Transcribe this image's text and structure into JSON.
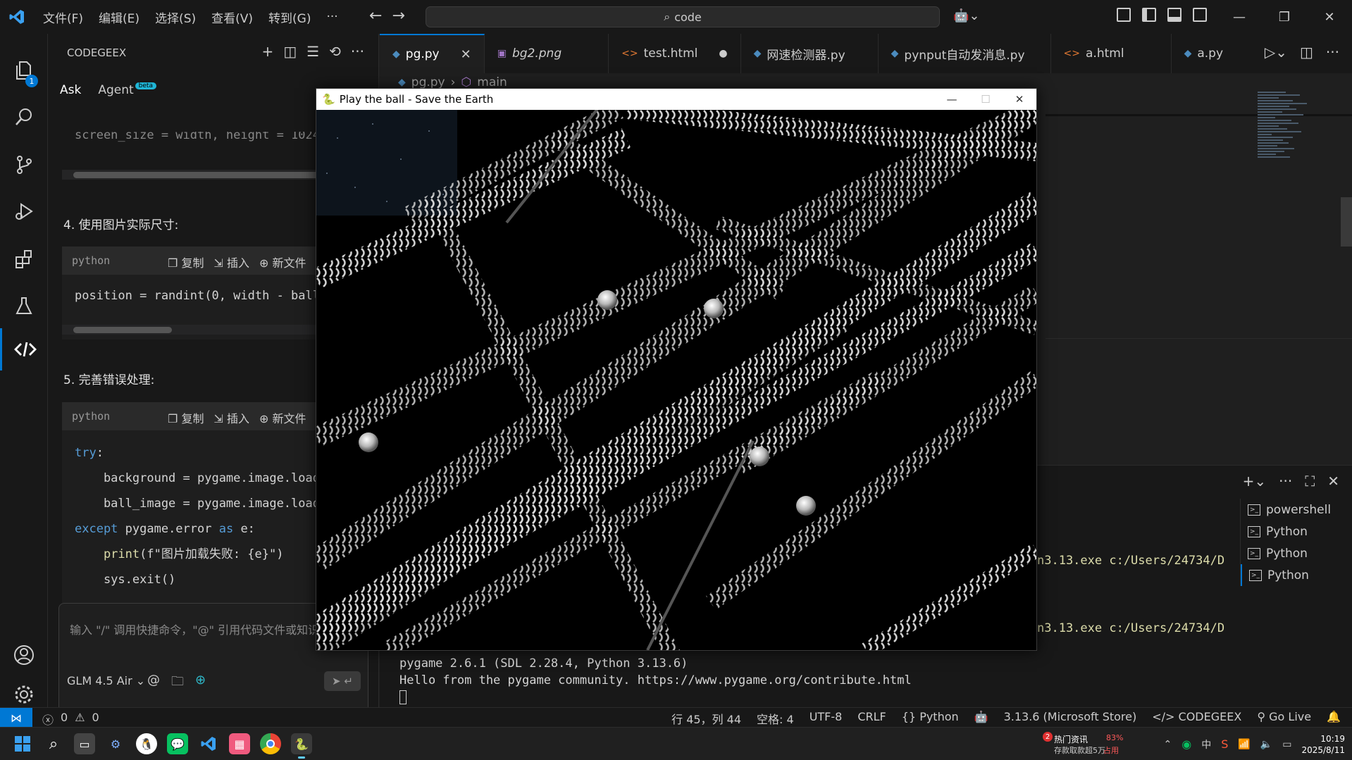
{
  "titlebar": {
    "menu": [
      "文件(F)",
      "编辑(E)",
      "选择(S)",
      "查看(V)",
      "转到(G)",
      "···"
    ],
    "search": "code"
  },
  "activity": {
    "explorer_badge": "1"
  },
  "sidepanel": {
    "title": "CODEGEEX",
    "tabs": {
      "ask": "Ask",
      "agent": "Agent",
      "beta": "beta"
    },
    "partial_line": "screen_size = width, height = 1024",
    "step4": "4. 使用图片实际尺寸:",
    "step5": "5. 完善错误处理:",
    "code_lang": "python",
    "code_actions": {
      "copy": "复制",
      "insert": "插入",
      "newfile": "新文件"
    },
    "code4": "position = randint(0, width - ball",
    "code5": {
      "l1_kw": "try",
      "l1_rest": ":",
      "l2": "    background = pygame.image.load",
      "l3": "    ball_image = pygame.image.load",
      "l4_kw": "except",
      "l4_mid": " pygame.error ",
      "l4_as": "as",
      "l4_rest": " e:",
      "l5_fn": "    print",
      "l5_rest": "(f\"图片加载失败: {e}\")",
      "l6": "    sys.exit()"
    },
    "input_placeholder": "输入 \"/\" 调用快捷命令，\"@\" 引用代码文件或知识",
    "model": "GLM 4.5 Air"
  },
  "tabs": [
    {
      "name": "pg.py",
      "kind": "py",
      "active": true,
      "suffix": "close"
    },
    {
      "name": "bg2.png",
      "kind": "img",
      "italic": true
    },
    {
      "name": "test.html",
      "kind": "html",
      "suffix": "dot"
    },
    {
      "name": "网速检测器.py",
      "kind": "py"
    },
    {
      "name": "pynput自动发消息.py",
      "kind": "py"
    },
    {
      "name": "a.html",
      "kind": "html"
    },
    {
      "name": "a.py",
      "kind": "py"
    }
  ],
  "breadcrumb": {
    "file": "pg.py",
    "symbol": "main"
  },
  "terminal": {
    "line1": "n3.13.exe c:/Users/24734/D",
    "line2": "n3.13.exe c:/Users/24734/D",
    "line3": "pygame 2.6.1 (SDL 2.28.4, Python 3.13.6)",
    "line4": "Hello from the pygame community. https://www.pygame.org/contribute.html",
    "list": [
      "powershell",
      "Python",
      "Python",
      "Python"
    ]
  },
  "game": {
    "title": "Play the ball - Save the Earth"
  },
  "statusbar": {
    "errors": "0",
    "warnings": "0",
    "position": "行 45，列 44",
    "spaces": "空格: 4",
    "encoding": "UTF-8",
    "eol": "CRLF",
    "language": "Python",
    "interpreter": "3.13.6 (Microsoft Store)",
    "codegeex": "CODEGEEX",
    "golive": "Go Live"
  },
  "taskbar": {
    "news_count": "2",
    "news_title": "热门资讯",
    "news_sub": "存款取款超5万",
    "cpu": "83%",
    "cpu_label": "占用",
    "ime": "中",
    "time": "10:19",
    "date": "2025/8/11"
  },
  "colors": {
    "accent": "#0078d4",
    "background": "#1f1f1f",
    "sidebar": "#181818"
  }
}
